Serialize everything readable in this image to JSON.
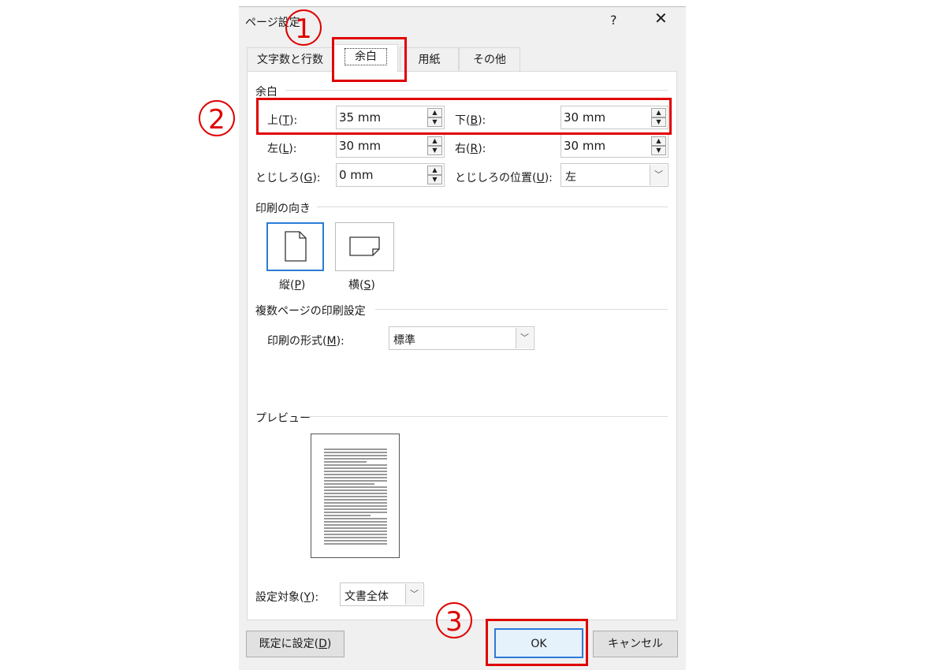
{
  "dialog": {
    "title": "ページ設定",
    "help": "?",
    "close": "✕"
  },
  "tabs": [
    {
      "label": "文字数と行数"
    },
    {
      "label": "余白"
    },
    {
      "label": "用紙"
    },
    {
      "label": "その他"
    }
  ],
  "margins": {
    "group_label": "余白",
    "top": {
      "label_pre": "上(",
      "key": "T",
      "label_post": "):",
      "value": "35 mm"
    },
    "bottom": {
      "label_pre": "下(",
      "key": "B",
      "label_post": "):",
      "value": "30 mm"
    },
    "left": {
      "label_pre": "左(",
      "key": "L",
      "label_post": "):",
      "value": "30 mm"
    },
    "right": {
      "label_pre": "右(",
      "key": "R",
      "label_post": "):",
      "value": "30 mm"
    },
    "gutter": {
      "label_pre": "とじしろ(",
      "key": "G",
      "label_post": "):",
      "value": "0 mm"
    },
    "gutter_pos": {
      "label_pre": "とじしろの位置(",
      "key": "U",
      "label_post": "):",
      "value": "左"
    }
  },
  "orientation": {
    "group_label": "印刷の向き",
    "portrait": {
      "label_pre": "縦(",
      "key": "P",
      "label_post": ")"
    },
    "landscape": {
      "label_pre": "横(",
      "key": "S",
      "label_post": ")"
    }
  },
  "multipage": {
    "group_label": "複数ページの印刷設定",
    "format": {
      "label_pre": "印刷の形式(",
      "key": "M",
      "label_post": "):",
      "value": "標準"
    }
  },
  "preview": {
    "group_label": "プレビュー"
  },
  "apply_to": {
    "label_pre": "設定対象(",
    "key": "Y",
    "label_post": "):",
    "value": "文書全体"
  },
  "buttons": {
    "default": {
      "label_pre": "既定に設定(",
      "key": "D",
      "label_post": ")"
    },
    "ok": "OK",
    "cancel": "キャンセル"
  },
  "annotations": [
    "1",
    "2",
    "3"
  ],
  "colors": {
    "annotation": "#e00000",
    "dialog_bg": "#f0f0f0",
    "focus": "#2b7bd8"
  }
}
